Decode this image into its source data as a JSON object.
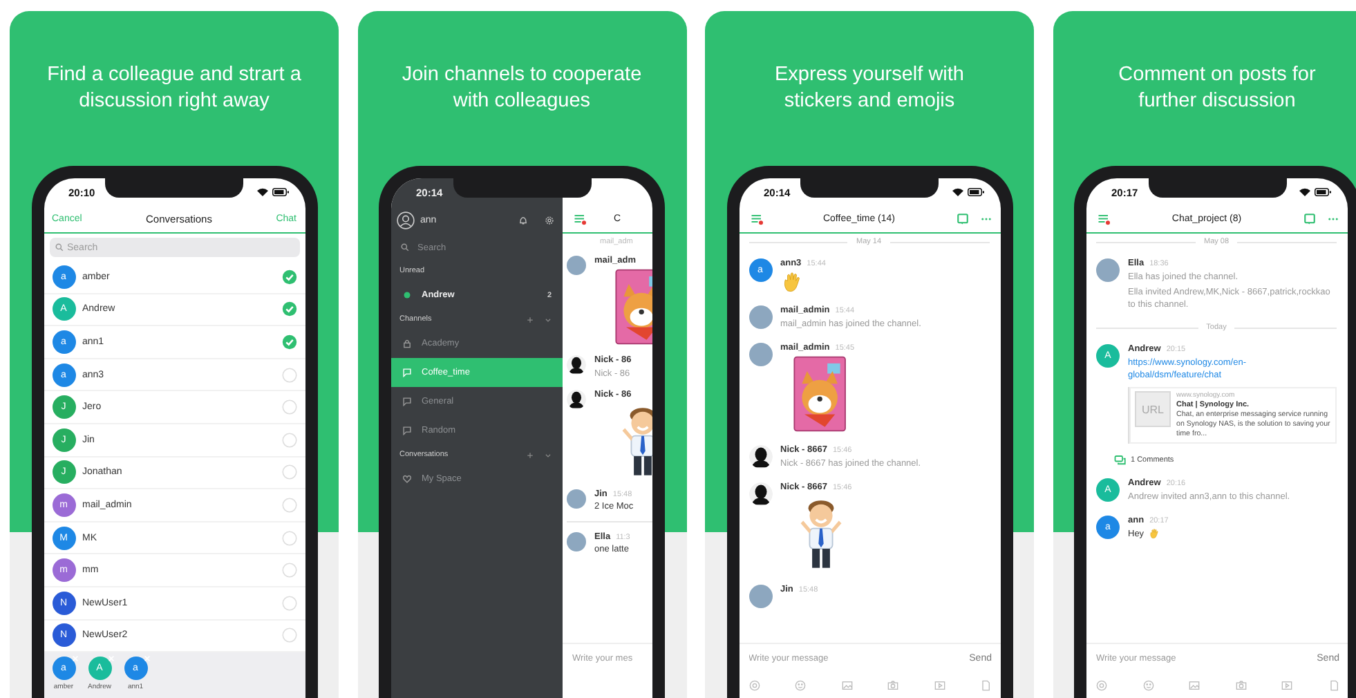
{
  "panels": [
    {
      "kind": "contacts",
      "headline": "Find a colleague and strart a\ndiscussion right away",
      "time": "20:10",
      "header": {
        "cancel": "Cancel",
        "title": "Conversations",
        "action": "Chat"
      },
      "search": {
        "placeholder": "Search"
      },
      "contacts": [
        {
          "avatar": {
            "kind": "letter",
            "letter": "a",
            "color": "#1e88e5"
          },
          "name": "amber",
          "checked": true
        },
        {
          "avatar": {
            "kind": "letter",
            "letter": "A",
            "color": "#1abc9c"
          },
          "name": "Andrew",
          "checked": true
        },
        {
          "avatar": {
            "kind": "letter",
            "letter": "a",
            "color": "#1e88e5"
          },
          "name": "ann1",
          "checked": true
        },
        {
          "avatar": {
            "kind": "letter",
            "letter": "a",
            "color": "#1e88e5"
          },
          "name": "ann3",
          "checked": false
        },
        {
          "avatar": {
            "kind": "letter",
            "letter": "J",
            "color": "#27ae60"
          },
          "name": "Jero",
          "checked": false
        },
        {
          "avatar": {
            "kind": "letter",
            "letter": "J",
            "color": "#27ae60"
          },
          "name": "Jin",
          "checked": false
        },
        {
          "avatar": {
            "kind": "letter",
            "letter": "J",
            "color": "#27ae60"
          },
          "name": "Jonathan",
          "checked": false
        },
        {
          "avatar": {
            "kind": "letter",
            "letter": "m",
            "color": "#9b6bd6"
          },
          "name": "mail_admin",
          "checked": false
        },
        {
          "avatar": {
            "kind": "letter",
            "letter": "M",
            "color": "#1e88e5"
          },
          "name": "MK",
          "checked": false
        },
        {
          "avatar": {
            "kind": "letter",
            "letter": "m",
            "color": "#9b6bd6"
          },
          "name": "mm",
          "checked": false
        },
        {
          "avatar": {
            "kind": "letter",
            "letter": "N",
            "color": "#2a5bd7"
          },
          "name": "NewUser1",
          "checked": false
        },
        {
          "avatar": {
            "kind": "letter",
            "letter": "N",
            "color": "#2a5bd7"
          },
          "name": "NewUser2",
          "checked": false
        }
      ],
      "chosen": [
        {
          "avatar": {
            "kind": "letter",
            "letter": "a",
            "color": "#1e88e5"
          },
          "name": "amber"
        },
        {
          "avatar": {
            "kind": "letter",
            "letter": "A",
            "color": "#1abc9c"
          },
          "name": "Andrew"
        },
        {
          "avatar": {
            "kind": "letter",
            "letter": "a",
            "color": "#1e88e5"
          },
          "name": "ann1"
        }
      ]
    },
    {
      "kind": "drawer",
      "headline": "Join channels to cooperate\nwith colleagues",
      "time": "20:14",
      "user": "ann",
      "search": {
        "placeholder": "Search"
      },
      "sections": [
        {
          "title": "Unread",
          "addable": false,
          "items": [
            {
              "kind": "unread",
              "label": "Andrew",
              "badge": "2",
              "selected": false
            }
          ]
        },
        {
          "title": "Channels",
          "addable": true,
          "items": [
            {
              "kind": "private",
              "label": "Academy",
              "selected": false
            },
            {
              "kind": "channel",
              "label": "Coffee_time",
              "selected": true
            },
            {
              "kind": "channel",
              "label": "General",
              "selected": false
            },
            {
              "kind": "channel",
              "label": "Random",
              "selected": false
            }
          ]
        },
        {
          "title": "Conversations",
          "addable": true,
          "items": [
            {
              "kind": "space",
              "label": "My Space",
              "selected": false
            }
          ]
        }
      ],
      "peek": {
        "title": "C",
        "messages": [
          {
            "kind": "cut",
            "text": "mail_adm"
          },
          {
            "kind": "message",
            "avatar": {
              "kind": "photo"
            },
            "author": "mail_adm",
            "body": [
              {
                "kind": "dog_sticker"
              }
            ]
          },
          {
            "kind": "message",
            "avatar": {
              "kind": "silhouette"
            },
            "author": "Nick - 86",
            "body": [
              {
                "kind": "note",
                "text": "Nick - 86"
              }
            ]
          },
          {
            "kind": "message",
            "avatar": {
              "kind": "silhouette"
            },
            "author": "Nick - 86",
            "body": [
              {
                "kind": "man_sticker"
              }
            ]
          },
          {
            "kind": "message",
            "avatar": {
              "kind": "photo"
            },
            "author": "Jin",
            "time": "15:48",
            "body": [
              {
                "kind": "text",
                "text": "2 Ice Moc"
              }
            ]
          },
          {
            "kind": "rule"
          },
          {
            "kind": "message",
            "avatar": {
              "kind": "photo"
            },
            "author": "Ella",
            "time": "11:3",
            "body": [
              {
                "kind": "text",
                "text": "one latte"
              }
            ]
          }
        ],
        "compose": {
          "placeholder": "Write your mes"
        }
      }
    },
    {
      "kind": "chat",
      "headline": "Express yourself with\nstickers and emojis",
      "time": "20:14",
      "title": "Coffee_time (14)",
      "messages": [
        {
          "kind": "date",
          "label": "May 14"
        },
        {
          "kind": "message",
          "avatar": {
            "kind": "letter",
            "letter": "a",
            "color": "#1e88e5"
          },
          "author": "ann3",
          "time": "15:44",
          "body": [
            {
              "kind": "wave"
            }
          ]
        },
        {
          "kind": "message",
          "avatar": {
            "kind": "photo"
          },
          "author": "mail_admin",
          "time": "15:44",
          "body": [
            {
              "kind": "note",
              "text": "mail_admin has joined the channel."
            }
          ]
        },
        {
          "kind": "message",
          "avatar": {
            "kind": "photo"
          },
          "author": "mail_admin",
          "time": "15:45",
          "body": [
            {
              "kind": "dog_sticker"
            }
          ]
        },
        {
          "kind": "message",
          "avatar": {
            "kind": "silhouette"
          },
          "author": "Nick - 8667",
          "time": "15:46",
          "body": [
            {
              "kind": "note",
              "text": "Nick - 8667 has joined the channel."
            }
          ]
        },
        {
          "kind": "message",
          "avatar": {
            "kind": "silhouette"
          },
          "author": "Nick - 8667",
          "time": "15:46",
          "body": [
            {
              "kind": "man_sticker"
            }
          ]
        },
        {
          "kind": "message",
          "avatar": {
            "kind": "photo"
          },
          "author": "Jin",
          "time": "15:48"
        }
      ],
      "compose": {
        "placeholder": "Write your message",
        "send": "Send"
      }
    },
    {
      "kind": "chat",
      "headline": "Comment on posts for\nfurther discussion",
      "time": "20:17",
      "title": "Chat_project (8)",
      "messages": [
        {
          "kind": "date",
          "label": "May 08"
        },
        {
          "kind": "message",
          "avatar": {
            "kind": "photo"
          },
          "author": "Ella",
          "time": "18:36",
          "body": [
            {
              "kind": "note",
              "text": "Ella has joined the channel."
            },
            {
              "kind": "note",
              "text": "Ella invited Andrew,MK,Nick - 8667,patrick,rockkao to this channel."
            }
          ]
        },
        {
          "kind": "date",
          "label": "Today"
        },
        {
          "kind": "message",
          "avatar": {
            "kind": "letter",
            "letter": "A",
            "color": "#1abc9c"
          },
          "author": "Andrew",
          "time": "20:15",
          "body": [
            {
              "kind": "link",
              "text": "https://www.synology.com/en-global/dsm/feature/chat"
            },
            {
              "kind": "preview",
              "thumb": "URL",
              "site": "www.synology.com",
              "title": "Chat | Synology Inc.",
              "summary": "Chat, an enterprise messaging service running on Synology NAS, is the solution to saving your time fro..."
            },
            {
              "kind": "comments",
              "text": "1 Comments"
            }
          ]
        },
        {
          "kind": "message",
          "avatar": {
            "kind": "letter",
            "letter": "A",
            "color": "#1abc9c"
          },
          "author": "Andrew",
          "time": "20:16",
          "body": [
            {
              "kind": "note",
              "text": "Andrew invited ann3,ann to this channel."
            }
          ]
        },
        {
          "kind": "message",
          "avatar": {
            "kind": "letter",
            "letter": "a",
            "color": "#1e88e5"
          },
          "author": "ann",
          "time": "20:17",
          "body": [
            {
              "kind": "greeting",
              "text": "Hey"
            }
          ]
        }
      ],
      "compose": {
        "placeholder": "Write your message",
        "send": "Send"
      }
    }
  ]
}
